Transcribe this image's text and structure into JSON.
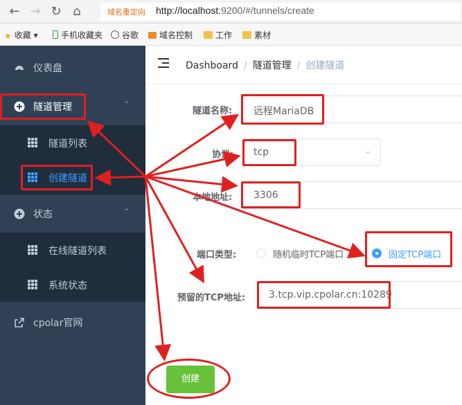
{
  "browser": {
    "redirect_tag": "域名重定向",
    "url_host": "http://localhost",
    "url_rest": ":9200/#/tunnels/create",
    "bookmarks": [
      "收藏",
      "手机收藏夹",
      "谷歌",
      "域名控制",
      "工作",
      "素材"
    ]
  },
  "sidebar": {
    "items": [
      {
        "label": "仪表盘"
      },
      {
        "label": "隧道管理"
      },
      {
        "label": "隧道列表"
      },
      {
        "label": "创建隧道"
      },
      {
        "label": "状态"
      },
      {
        "label": "在线隧道列表"
      },
      {
        "label": "系统状态"
      },
      {
        "label": "cpolar官网"
      }
    ]
  },
  "breadcrumb": {
    "items": [
      "Dashboard",
      "隧道管理",
      "创建隧道"
    ]
  },
  "form": {
    "name_label": "隧道名称:",
    "name_value": "远程MariaDB",
    "protocol_label": "协议:",
    "protocol_value": "tcp",
    "local_label": "本地地址:",
    "local_value": "3306",
    "port_type_label": "端口类型:",
    "port_type_options": [
      "随机临时TCP端口",
      "固定TCP端口"
    ],
    "port_type_selected": "固定TCP端口",
    "reserved_label": "预留的TCP地址:",
    "reserved_value": "3.tcp.vip.cpolar.cn:10289",
    "submit_label": "创建"
  },
  "colors": {
    "sidebar_bg": "#304156",
    "submenu_bg": "#1f2d3d",
    "active": "#409eff",
    "success": "#67c23a",
    "annotation": "#e02020"
  }
}
